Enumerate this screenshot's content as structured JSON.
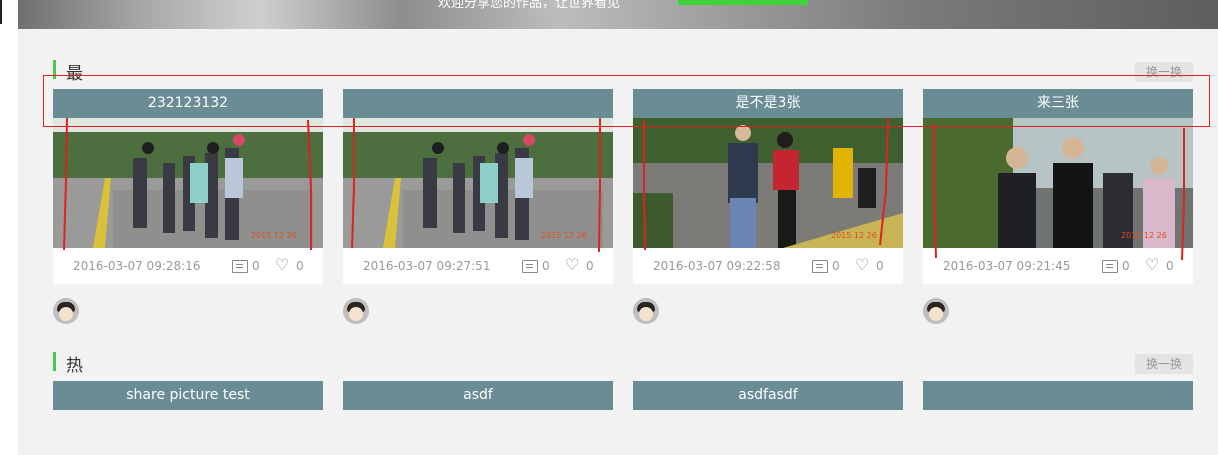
{
  "banner": {
    "text": "欢迎分享您的作品，让世界看见"
  },
  "latest": {
    "title": "最新",
    "refresh_label": "换一换",
    "cards": [
      {
        "title": "232123132",
        "time": "2016-03-07 09:28:16",
        "comments": "0",
        "likes": "0",
        "photo_stamp": "2015 12 26"
      },
      {
        "title": "",
        "time": "2016-03-07 09:27:51",
        "comments": "0",
        "likes": "0",
        "photo_stamp": "2015 12 26"
      },
      {
        "title": "是不是3张",
        "time": "2016-03-07 09:22:58",
        "comments": "0",
        "likes": "0",
        "photo_stamp": "2015 12 26"
      },
      {
        "title": "来三张",
        "time": "2016-03-07 09:21:45",
        "comments": "0",
        "likes": "0",
        "photo_stamp": "2015 12 26"
      }
    ]
  },
  "hot": {
    "title": "热门",
    "refresh_label": "换一换",
    "cards": [
      {
        "title": "share picture test"
      },
      {
        "title": "asdf"
      },
      {
        "title": "asdfasdf"
      },
      {
        "title": ""
      }
    ]
  },
  "icons": {
    "comment": "comment-icon",
    "like": "heart-icon",
    "avatar": "user-avatar"
  },
  "colors": {
    "card_title_bg": "#6a8d95",
    "accent": "#47c847",
    "annotation": "#d22222"
  }
}
